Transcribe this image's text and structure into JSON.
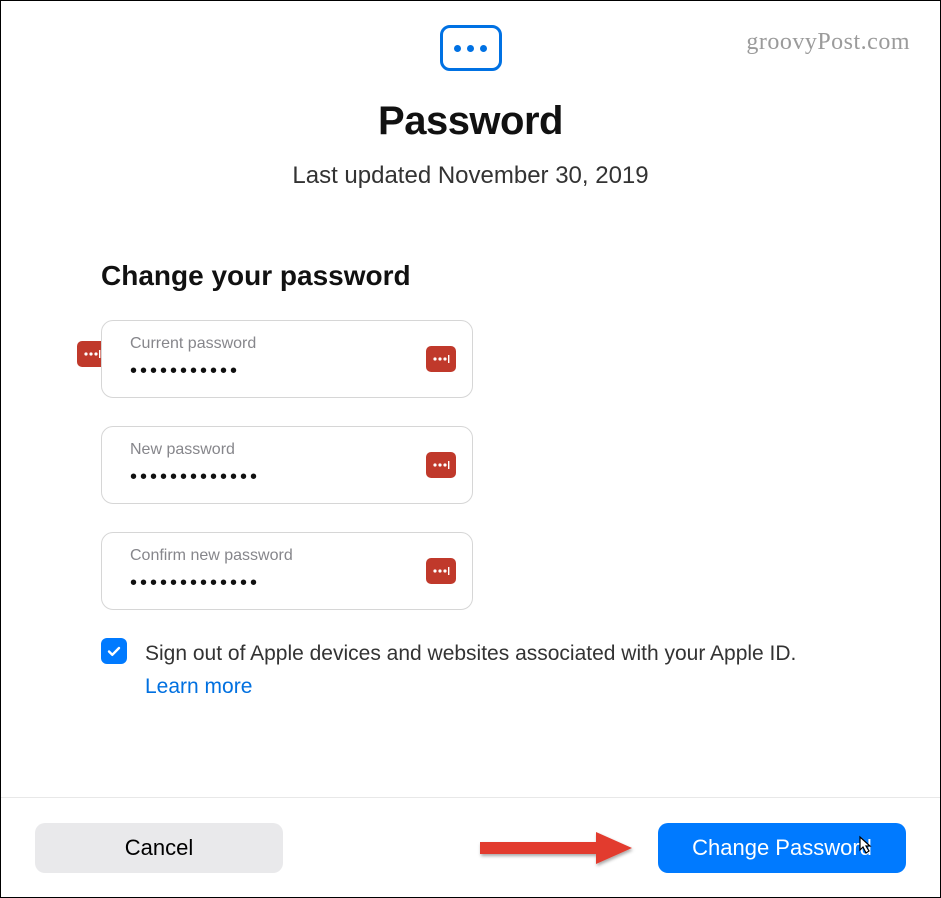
{
  "watermark": "groovyPost.com",
  "header": {
    "title": "Password",
    "subtitle": "Last updated November 30, 2019"
  },
  "form": {
    "heading": "Change your password",
    "fields": [
      {
        "label": "Current password",
        "value": "•••••••••••"
      },
      {
        "label": "New password",
        "value": "•••••••••••••"
      },
      {
        "label": "Confirm new password",
        "value": "•••••••••••••"
      }
    ],
    "checkbox": {
      "checked": true,
      "text": "Sign out of Apple devices and websites associated with your Apple ID. ",
      "link": "Learn more"
    }
  },
  "footer": {
    "cancel": "Cancel",
    "submit": "Change Password"
  }
}
